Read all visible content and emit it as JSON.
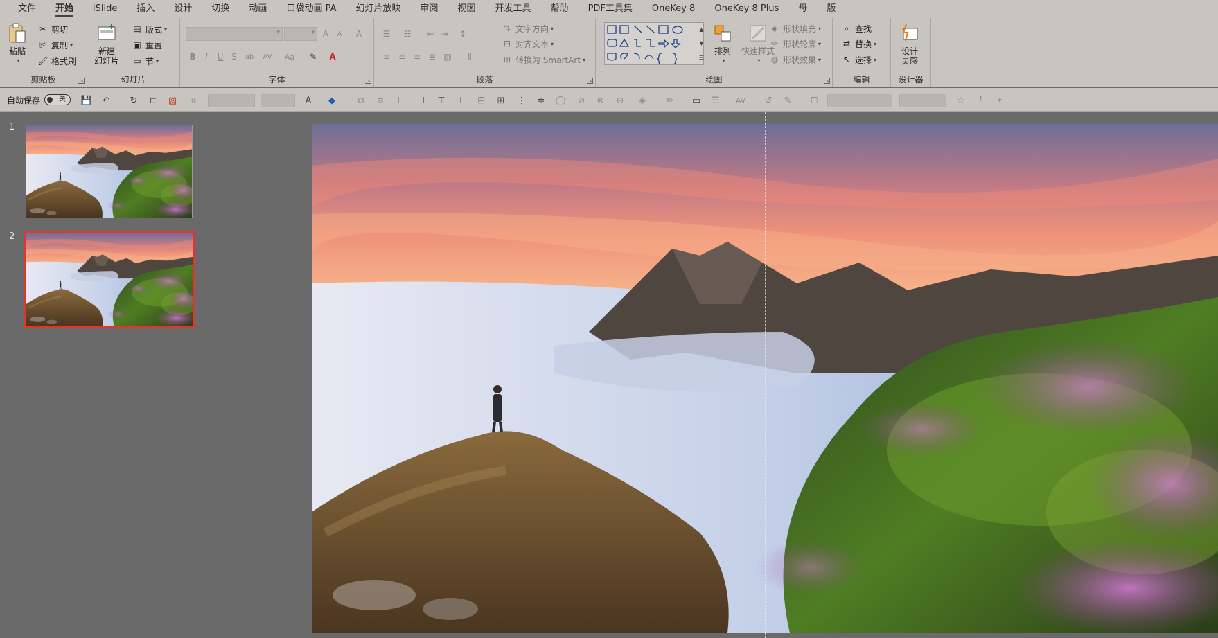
{
  "menu": {
    "tabs": [
      "文件",
      "开始",
      "iSlide",
      "插入",
      "设计",
      "切换",
      "动画",
      "口袋动画 PA",
      "幻灯片放映",
      "审阅",
      "视图",
      "开发工具",
      "帮助",
      "PDF工具集",
      "OneKey 8",
      "OneKey 8 Plus",
      "母",
      "版"
    ],
    "active_tab": "开始"
  },
  "clipboard": {
    "paste": "粘贴",
    "cut": "剪切",
    "copy": "复制",
    "format_painter": "格式刷",
    "label": "剪贴板"
  },
  "slides_group": {
    "new_slide_line1": "新建",
    "new_slide_line2": "幻灯片",
    "layout": "版式",
    "reset": "重置",
    "section": "节",
    "label": "幻灯片"
  },
  "font_group": {
    "label": "字体"
  },
  "paragraph_group": {
    "text_direction": "文字方向",
    "align_text": "对齐文本",
    "convert_smartart": "转换为 SmartArt",
    "label": "段落"
  },
  "drawing_group": {
    "arrange": "排列",
    "quick_styles": "快速样式",
    "shape_fill": "形状填充",
    "shape_outline": "形状轮廓",
    "shape_effects": "形状效果",
    "label": "绘图"
  },
  "editing_group": {
    "find": "查找",
    "replace": "替换",
    "select": "选择",
    "label": "编辑"
  },
  "designer_group": {
    "design_ideas_line1": "设计",
    "design_ideas_line2": "灵感",
    "label": "设计器"
  },
  "qat": {
    "autosave_label": "自动保存",
    "autosave_state": "关"
  },
  "slides": [
    {
      "number": "1",
      "selected": false
    },
    {
      "number": "2",
      "selected": true
    }
  ],
  "colors": {
    "ribbon_bg": "#c8c5c0",
    "workspace_bg": "#6a6a6a",
    "selection_red": "#e0352b"
  }
}
